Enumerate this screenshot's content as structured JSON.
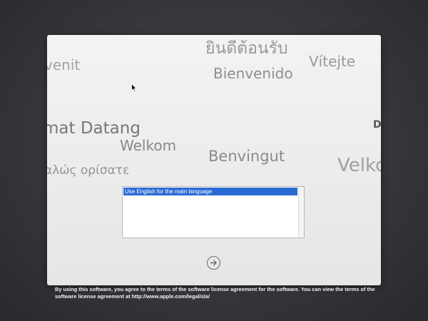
{
  "greetings": {
    "thai": "ยินดีต้อนรับ",
    "venit": "venit",
    "bienvenido": "Bienvenido",
    "vitejte": "Vítejte",
    "datang": "mat Datang",
    "welkom": "Welkom",
    "benvingut": "Benvingut",
    "greek": "αλώς ορίσατε",
    "velkom": "Velko",
    "d": "D"
  },
  "language_list": {
    "items": [
      {
        "label": "Use English for the main language",
        "selected": true
      }
    ],
    "selection_color": "#2a6bd3"
  },
  "continue_button": {
    "icon": "arrow-right-icon"
  },
  "license": {
    "text": "By using this software, you agree to the terms of the software license agreement for the software. You can view the terms of the software license agreement at ",
    "link": "http://www.apple.com/legal/sla/"
  }
}
